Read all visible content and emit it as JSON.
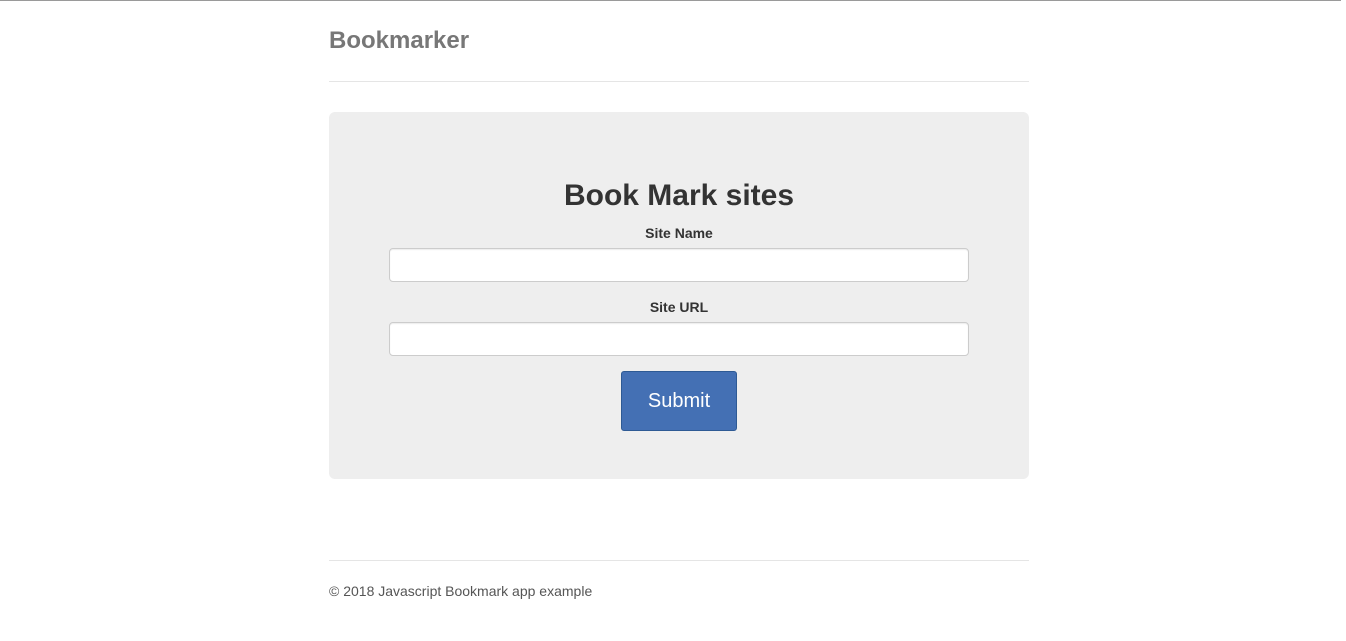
{
  "header": {
    "brand": "Bookmarker"
  },
  "form": {
    "title": "Book Mark sites",
    "site_name_label": "Site Name",
    "site_name_value": "",
    "site_url_label": "Site URL",
    "site_url_value": "",
    "submit_label": "Submit"
  },
  "footer": {
    "text": "© 2018 Javascript Bookmark app example"
  },
  "colors": {
    "submit_bg": "#4470b4",
    "panel_bg": "#eeeeee",
    "brand_text": "#777777"
  }
}
